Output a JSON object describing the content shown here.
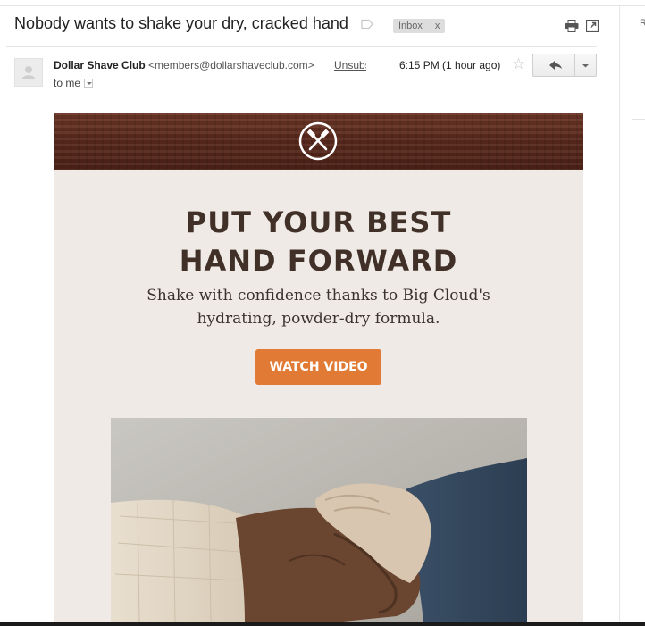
{
  "thread": {
    "subject": "Nobody wants to shake your dry, cracked hand",
    "label": "Inbox",
    "label_remove": "x"
  },
  "message": {
    "sender_name": "Dollar Shave Club",
    "sender_email": "<members@dollarshaveclub.com>",
    "unsubscribe": "Unsubscribe",
    "time": "6:15 PM (1 hour ago)",
    "recipient": "to me"
  },
  "email_body": {
    "headline_line1": "PUT YOUR BEST",
    "headline_line2": "HAND FORWARD",
    "subtext_line1": "Shake with confidence thanks to Big Cloud's",
    "subtext_line2": "hydrating, powder-dry formula.",
    "cta_label": "WATCH VIDEO"
  },
  "right_panel": {
    "clipped_text": "R"
  },
  "icons": {
    "label": "label-tag-icon",
    "print": "print-icon",
    "popout": "new-window-icon",
    "star": "star-icon",
    "reply": "reply-icon",
    "more": "chevron-down-icon",
    "avatar": "person-icon",
    "logo": "crossed-razors-logo"
  },
  "colors": {
    "cta": "#e07a34",
    "headline": "#403028",
    "panel_bg": "#efeae6",
    "wood": "#5a2a1d"
  }
}
